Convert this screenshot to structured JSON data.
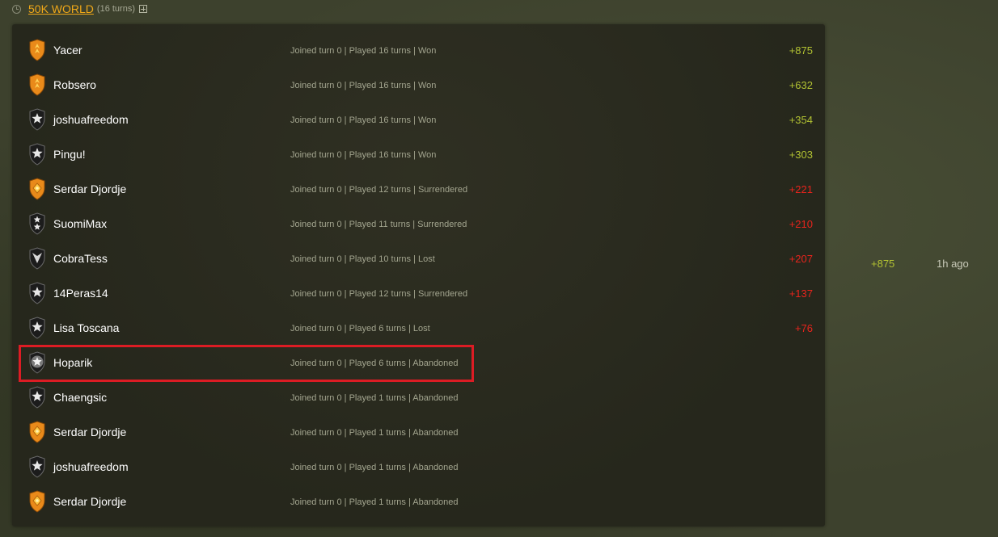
{
  "game": {
    "title": "50K WORLD",
    "turns_label": "(16 turns)"
  },
  "colors": {
    "title_link": "#f0a818",
    "points_positive": "#b2c232",
    "points_negative": "#e8241c",
    "highlight_border": "#dc1c24",
    "badge_gold": "#e98a1a",
    "badge_silver": "#1c1c1c"
  },
  "players": [
    {
      "name": "Yacer",
      "status": "Joined turn 0 | Played 16 turns | Won",
      "points": "+875",
      "points_sign": "positive",
      "badge": "gold-shield-icon",
      "badge_type": "gold",
      "highlighted": false
    },
    {
      "name": "Robsero",
      "status": "Joined turn 0 | Played 16 turns | Won",
      "points": "+632",
      "points_sign": "positive",
      "badge": "gold-shield-icon",
      "badge_type": "gold",
      "highlighted": false
    },
    {
      "name": "joshuafreedom",
      "status": "Joined turn 0 | Played 16 turns | Won",
      "points": "+354",
      "points_sign": "positive",
      "badge": "star-shield-icon",
      "badge_type": "star",
      "highlighted": false
    },
    {
      "name": "Pingu!",
      "status": "Joined turn 0 | Played 16 turns | Won",
      "points": "+303",
      "points_sign": "positive",
      "badge": "star-shield-icon",
      "badge_type": "star",
      "highlighted": false
    },
    {
      "name": "Serdar Djordje",
      "status": "Joined turn 0 | Played 12 turns | Surrendered",
      "points": "+221",
      "points_sign": "negative",
      "badge": "gold-diamond-shield-icon",
      "badge_type": "gold-diamond",
      "highlighted": false
    },
    {
      "name": "SuomiMax",
      "status": "Joined turn 0 | Played 11 turns | Surrendered",
      "points": "+210",
      "points_sign": "negative",
      "badge": "double-star-shield-icon",
      "badge_type": "double-star",
      "highlighted": false
    },
    {
      "name": "CobraTess",
      "status": "Joined turn 0 | Played 10 turns | Lost",
      "points": "+207",
      "points_sign": "negative",
      "badge": "chevron-shield-icon",
      "badge_type": "chevron",
      "highlighted": false
    },
    {
      "name": "14Peras14",
      "status": "Joined turn 0 | Played 12 turns | Surrendered",
      "points": "+137",
      "points_sign": "negative",
      "badge": "star-shield-icon",
      "badge_type": "star",
      "highlighted": false
    },
    {
      "name": "Lisa Toscana",
      "status": "Joined turn 0 | Played 6 turns | Lost",
      "points": "+76",
      "points_sign": "negative",
      "badge": "star-shield-icon",
      "badge_type": "star",
      "highlighted": false
    },
    {
      "name": "Hoparik",
      "status": "Joined turn 0 | Played 6 turns | Abandoned",
      "points": "",
      "points_sign": "none",
      "badge": "star-circle-shield-icon",
      "badge_type": "star-circle",
      "highlighted": true
    },
    {
      "name": "Chaengsic",
      "status": "Joined turn 0 | Played 1 turns | Abandoned",
      "points": "",
      "points_sign": "none",
      "badge": "star-shield-icon",
      "badge_type": "star",
      "highlighted": false
    },
    {
      "name": "Serdar Djordje",
      "status": "Joined turn 0 | Played 1 turns | Abandoned",
      "points": "",
      "points_sign": "none",
      "badge": "gold-diamond-shield-icon",
      "badge_type": "gold-diamond",
      "highlighted": false
    },
    {
      "name": "joshuafreedom",
      "status": "Joined turn 0 | Played 1 turns | Abandoned",
      "points": "",
      "points_sign": "none",
      "badge": "star-shield-icon",
      "badge_type": "star",
      "highlighted": false
    },
    {
      "name": "Serdar Djordje",
      "status": "Joined turn 0 | Played 1 turns | Abandoned",
      "points": "",
      "points_sign": "none",
      "badge": "gold-diamond-shield-icon",
      "badge_type": "gold-diamond",
      "highlighted": false
    }
  ],
  "summary": {
    "points": "+875",
    "time_ago": "1h ago"
  }
}
